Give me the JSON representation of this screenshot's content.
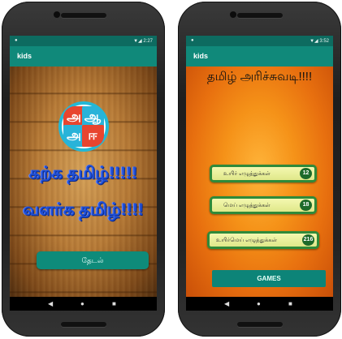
{
  "status_left": {
    "signal_text": "▼◢ 2:27",
    "icon": "●"
  },
  "status_right": {
    "signal_text": "▼◢ 3:52",
    "icon": "●"
  },
  "left_screen": {
    "app_title": "kids",
    "logo_letters": [
      "அ",
      "ஆ",
      "அ",
      "ஈ"
    ],
    "slogan_line1": "கற்க தமிழ்!!!!!",
    "slogan_line2": "வளர்க தமிழ்!!!!",
    "search_button": "தேடல்"
  },
  "right_screen": {
    "app_title": "kids",
    "headline": "தமிழ் அரிச்சுவடி!!!!",
    "menu": [
      {
        "label": "உயிர் எழுத்துக்கள்",
        "count": "12"
      },
      {
        "label": "மெய் எழுத்துக்கள்",
        "count": "18"
      },
      {
        "label": "உயிர்மெய் எழுத்துக்கள்",
        "count": "216"
      }
    ],
    "games_button": "GAMES"
  },
  "nav": {
    "back": "◀",
    "home": "●",
    "recent": "■"
  }
}
